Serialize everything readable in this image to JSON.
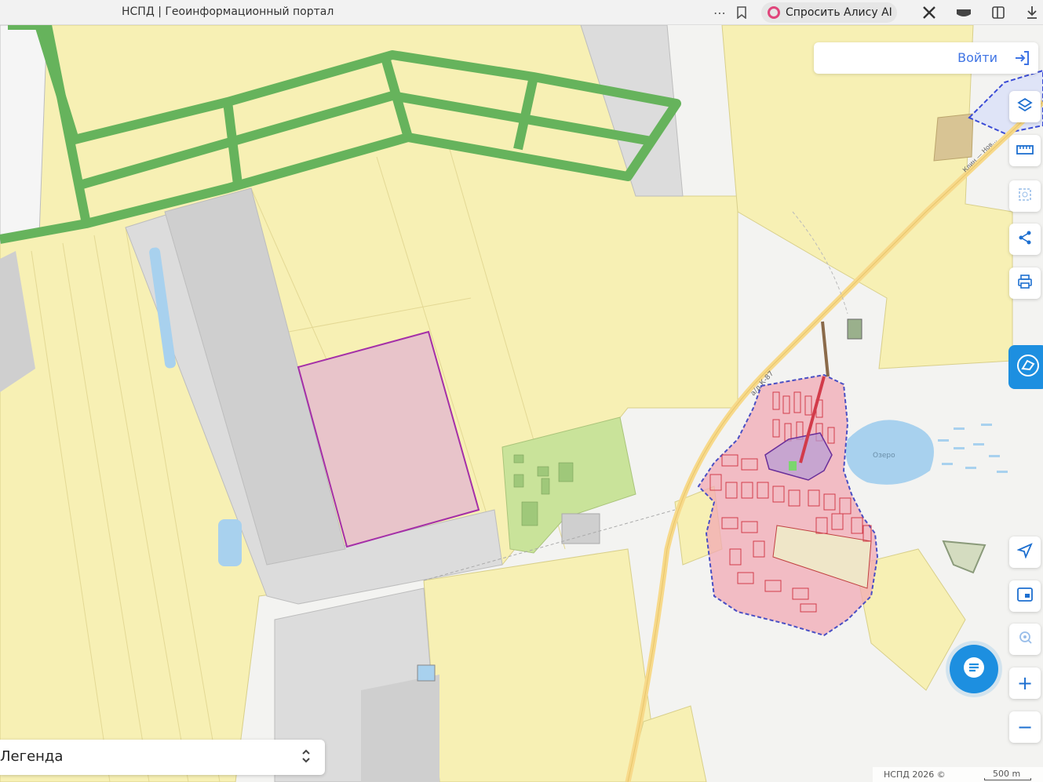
{
  "browser": {
    "tab_title": "НСПД | Геоинформационный портал",
    "alice_label": "Спросить Алису AI",
    "icons": [
      "more-icon",
      "bookmark-icon",
      "alice-icon",
      "extension-icon",
      "reader-icon",
      "bookmarks-panel-icon",
      "download-icon"
    ]
  },
  "map": {
    "login_label": "Войти",
    "controls": [
      "layers-icon",
      "ruler-icon",
      "area-select-icon",
      "share-icon",
      "print-icon",
      "service-icon",
      "geolocation-icon",
      "minimap-icon",
      "search-location-icon",
      "zoom-in-icon",
      "zoom-out-icon"
    ],
    "zoom_in_label": "+",
    "zoom_out_label": "−",
    "legend_label": "Легенда",
    "copyright": "НСПД 2026 ©",
    "scale_label": "500 m",
    "road_labels": [
      "а/д К-87",
      "Клин — Нов..."
    ],
    "lake_label": "Озеро",
    "colors": {
      "parcel": "#f7f0b4",
      "green_zone": "#66b35c",
      "selected_parcel": "#e8c4ca",
      "selected_border": "#a42fa8",
      "settlement": "#f2aab4",
      "water": "#a8d1ee",
      "accent": "#1d8fe0"
    }
  }
}
